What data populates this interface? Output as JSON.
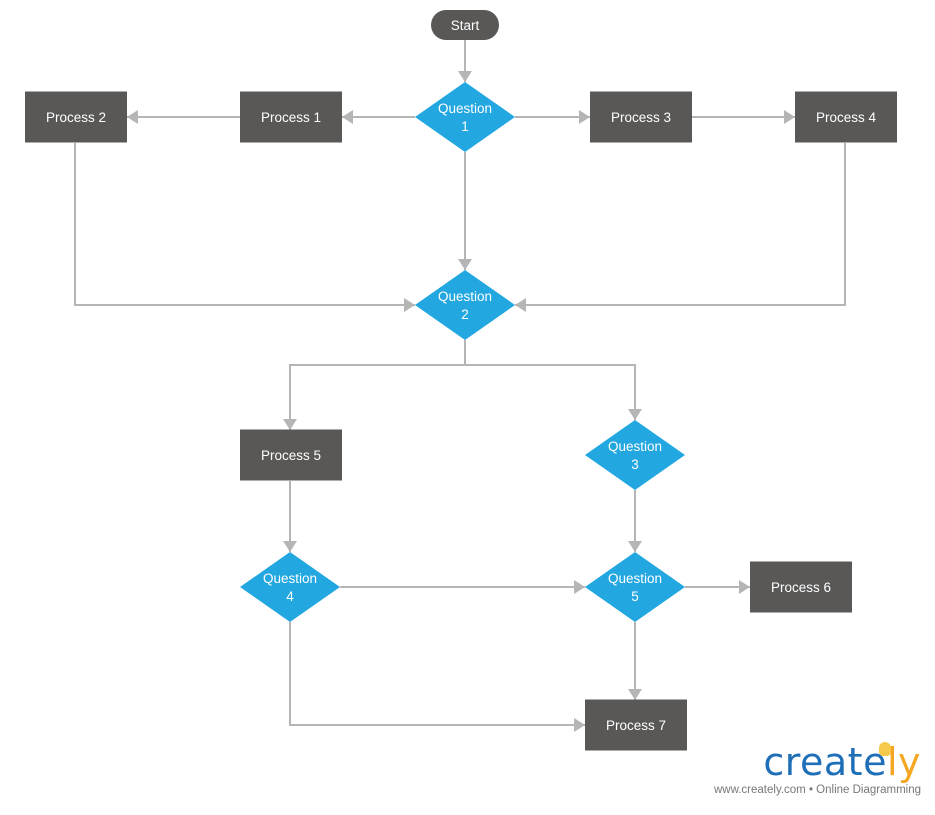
{
  "colors": {
    "process": "#595857",
    "decision": "#22a7e0",
    "terminal": "#595857",
    "connector": "#b5b5b5",
    "text": "#ffffff"
  },
  "nodes": [
    {
      "id": "start",
      "type": "terminal",
      "label": [
        "Start"
      ]
    },
    {
      "id": "q1",
      "type": "decision",
      "label": [
        "Question",
        "1"
      ]
    },
    {
      "id": "p1",
      "type": "process",
      "label": [
        "Process 1"
      ]
    },
    {
      "id": "p2",
      "type": "process",
      "label": [
        "Process 2"
      ]
    },
    {
      "id": "p3",
      "type": "process",
      "label": [
        "Process 3"
      ]
    },
    {
      "id": "p4",
      "type": "process",
      "label": [
        "Process 4"
      ]
    },
    {
      "id": "q2",
      "type": "decision",
      "label": [
        "Question",
        "2"
      ]
    },
    {
      "id": "p5",
      "type": "process",
      "label": [
        "Process 5"
      ]
    },
    {
      "id": "q3",
      "type": "decision",
      "label": [
        "Question",
        "3"
      ]
    },
    {
      "id": "q4",
      "type": "decision",
      "label": [
        "Question",
        "4"
      ]
    },
    {
      "id": "q5",
      "type": "decision",
      "label": [
        "Question",
        "5"
      ]
    },
    {
      "id": "p6",
      "type": "process",
      "label": [
        "Process 6"
      ]
    },
    {
      "id": "p7",
      "type": "process",
      "label": [
        "Process 7"
      ]
    }
  ],
  "edges": [
    {
      "from": "start",
      "to": "q1"
    },
    {
      "from": "q1",
      "to": "p1"
    },
    {
      "from": "p1",
      "to": "p2"
    },
    {
      "from": "q1",
      "to": "p3"
    },
    {
      "from": "p3",
      "to": "p4"
    },
    {
      "from": "q1",
      "to": "q2"
    },
    {
      "from": "p2",
      "to": "q2"
    },
    {
      "from": "p4",
      "to": "q2"
    },
    {
      "from": "q2",
      "to": "p5"
    },
    {
      "from": "q2",
      "to": "q3"
    },
    {
      "from": "p5",
      "to": "q4"
    },
    {
      "from": "q3",
      "to": "q5"
    },
    {
      "from": "q4",
      "to": "q5"
    },
    {
      "from": "q5",
      "to": "p6"
    },
    {
      "from": "q5",
      "to": "p7"
    },
    {
      "from": "q4",
      "to": "p7"
    }
  ],
  "logo": {
    "brand": "creately",
    "brand_main": "create",
    "brand_accent": "ly",
    "tagline": "www.creately.com • Online Diagramming"
  }
}
